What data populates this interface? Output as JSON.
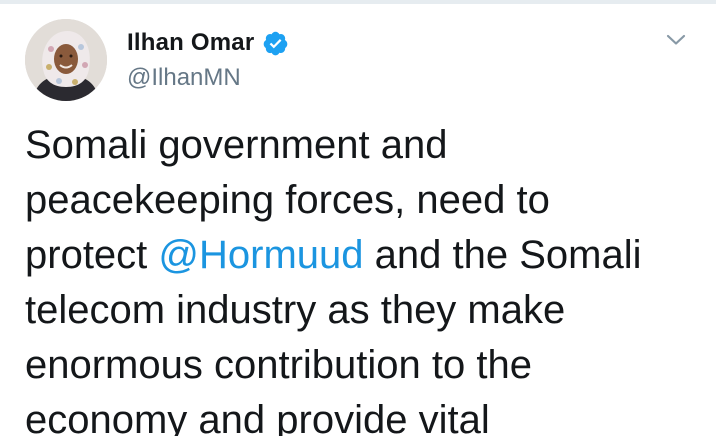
{
  "tweet": {
    "author": {
      "display_name": "Ilhan Omar",
      "handle": "@IlhanMN",
      "verified": true
    },
    "icons": {
      "verified": "verified-badge-icon",
      "menu": "chevron-down-icon"
    },
    "colors": {
      "text": "#14171a",
      "secondary": "#657786",
      "link": "#1b95e0",
      "verified": "#1da1f2"
    },
    "lines": [
      {
        "text": "Somali government and"
      },
      {
        "text": "peacekeeping forces, need to"
      },
      {
        "before": "protect ",
        "mention": "@Hormuud",
        "after": " and the Somali"
      },
      {
        "text": "telecom industry as they make"
      },
      {
        "text": "enormous contribution to the"
      },
      {
        "text": "economy and provide vital"
      }
    ]
  }
}
